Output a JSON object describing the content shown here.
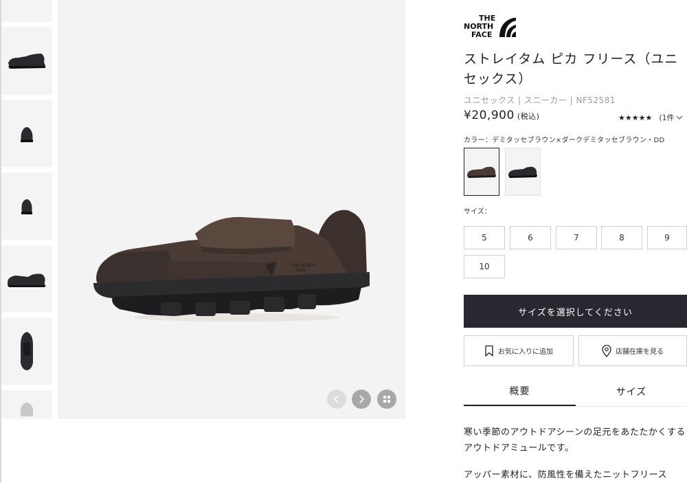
{
  "brand": {
    "logo_lines": [
      "THE",
      "NORTH",
      "FACE"
    ]
  },
  "product": {
    "title": "ストレイタム ピカ フリース（ユニセックス）",
    "category": "ユニセックス | スニーカー | NF52581",
    "price": "¥20,900",
    "tax_note": "(税込)",
    "rating": {
      "stars": "★★★★★",
      "count": "(1件",
      "value": 5,
      "max": 5
    },
    "color_label": "カラー：デミタッセブラウン×ダークデミタッセブラウン・DD",
    "colors": [
      "デミタッセブラウン×ダークデミタッセブラウン",
      "ブラック"
    ],
    "size_label": "サイズ：",
    "sizes": [
      "5",
      "6",
      "7",
      "8",
      "9",
      "10"
    ]
  },
  "actions": {
    "select_size": "サイズを選択してください",
    "favorite": "お気に入りに追加",
    "store_stock": "店舗在庫を見る"
  },
  "tabs": {
    "overview": "概要",
    "size": "サイズ"
  },
  "description": {
    "paragraph_1": "寒い季節のアウトドアシーンの足元をあたたかくするアウトドアミュールです。",
    "paragraph_2": "アッパー素材に、防風性を備えたニットフリース"
  },
  "colors": {
    "primary_button": "#272830",
    "shoe_brown": "#4a3b34",
    "image_bg": "#f3f3f3"
  },
  "icons": {
    "prev": "chevron-left-icon",
    "next": "chevron-right-icon",
    "grid": "grid-icon",
    "favorite": "bookmark-icon",
    "store": "location-pin-icon",
    "rating_dropdown": "chevron-down-icon"
  }
}
